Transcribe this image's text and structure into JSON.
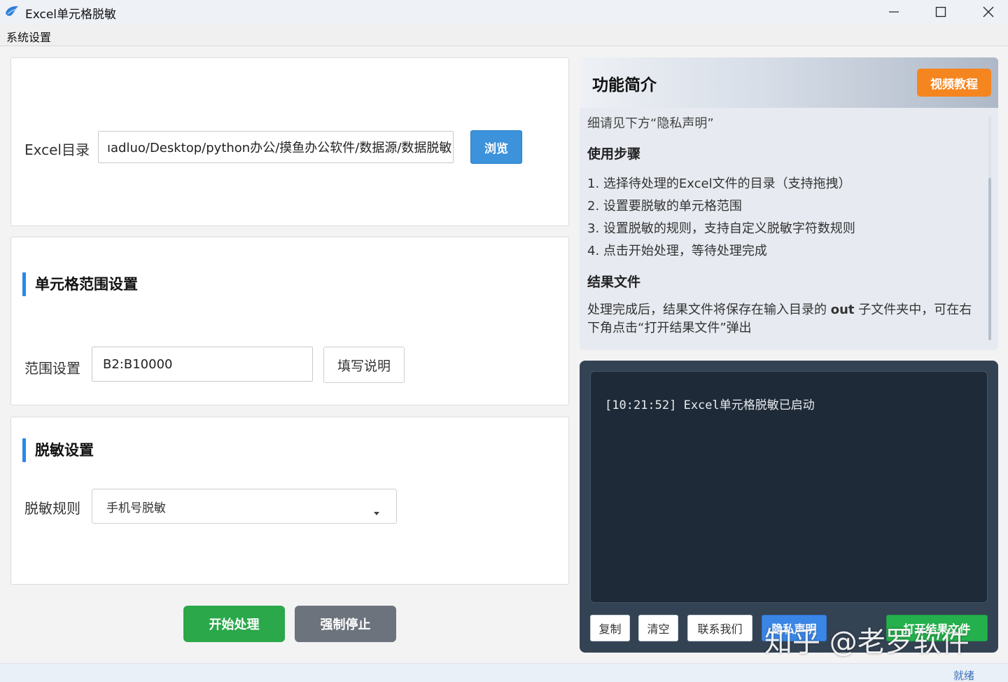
{
  "window": {
    "title": "Excel单元格脱敏"
  },
  "menu": {
    "items": [
      "系统设置"
    ]
  },
  "directory": {
    "label": "Excel目录",
    "value": "ıadluo/Desktop/python办公/摸鱼办公软件/数据源/数据脱敏",
    "browse_label": "浏览"
  },
  "range": {
    "section_title": "单元格范围设置",
    "label": "范围设置",
    "value": "B2:B10000",
    "help_label": "填写说明"
  },
  "masking": {
    "section_title": "脱敏设置",
    "label": "脱敏规则",
    "selected": "手机号脱敏"
  },
  "actions": {
    "start_label": "开始处理",
    "stop_label": "强制停止"
  },
  "intro": {
    "title": "功能简介",
    "video_label": "视频教程",
    "top_line": "细请见下方“隐私声明”",
    "steps_heading": "使用步骤",
    "steps": [
      "1. 选择待处理的Excel文件的目录（支持拖拽）",
      "2. 设置要脱敏的单元格范围",
      "3. 设置脱敏的规则，支持自定义脱敏字符数规则",
      "4. 点击开始处理，等待处理完成"
    ],
    "result_heading": "结果文件",
    "result_before": "处理完成后，结果文件将保存在输入目录的 ",
    "result_bold": "out",
    "result_after": " 子文件夹中，可在右下角点击“打开结果文件”弹出"
  },
  "log": {
    "lines": [
      "[10:21:52] Excel单元格脱敏已启动"
    ],
    "buttons": {
      "copy": "复制",
      "clear": "清空",
      "contact": "联系我们",
      "privacy": "隐私声明",
      "open_result": "打开结果文件"
    }
  },
  "watermark": "知乎 @老罗软件",
  "status": {
    "text": "就绪"
  },
  "colors": {
    "accent_blue": "#3c92db",
    "start_green": "#2aa84a",
    "stop_gray": "#6c737c",
    "video_orange": "#f5851f",
    "log_bg": "#1f2a38"
  }
}
